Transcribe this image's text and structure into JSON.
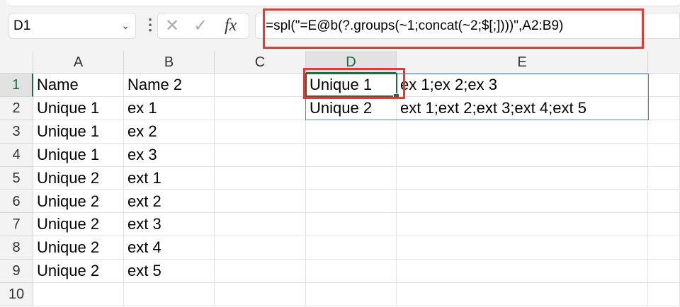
{
  "name_box": {
    "value": "D1"
  },
  "formula_bar": {
    "cancel_icon": "✕",
    "enter_icon": "✓",
    "fx_label": "fx",
    "formula": "=spl(\"=E@b(?.groups(~1;concat(~2;$[;])))\",A2:B9)"
  },
  "columns": [
    "A",
    "B",
    "C",
    "D",
    "E"
  ],
  "rows": [
    "1",
    "2",
    "3",
    "4",
    "5",
    "6",
    "7",
    "8",
    "9",
    "10"
  ],
  "cells": [
    [
      "Name",
      "Name 2",
      "",
      "Unique 1",
      "ex 1;ex 2;ex 3"
    ],
    [
      "Unique 1",
      "ex 1",
      "",
      "Unique 2",
      "ext 1;ext 2;ext 3;ext 4;ext 5"
    ],
    [
      "Unique 1",
      "ex 2",
      "",
      "",
      ""
    ],
    [
      "Unique 1",
      "ex 3",
      "",
      "",
      ""
    ],
    [
      "Unique 2",
      "ext 1",
      "",
      "",
      ""
    ],
    [
      "Unique 2",
      "ext 2",
      "",
      "",
      ""
    ],
    [
      "Unique 2",
      "ext 3",
      "",
      "",
      ""
    ],
    [
      "Unique 2",
      "ext 4",
      "",
      "",
      ""
    ],
    [
      "Unique 2",
      "ext 5",
      "",
      "",
      ""
    ],
    [
      "",
      "",
      "",
      "",
      ""
    ]
  ],
  "colors": {
    "selection": "#1e6c41",
    "highlight": "#e53935",
    "spill_border": "#4a7fd6"
  }
}
